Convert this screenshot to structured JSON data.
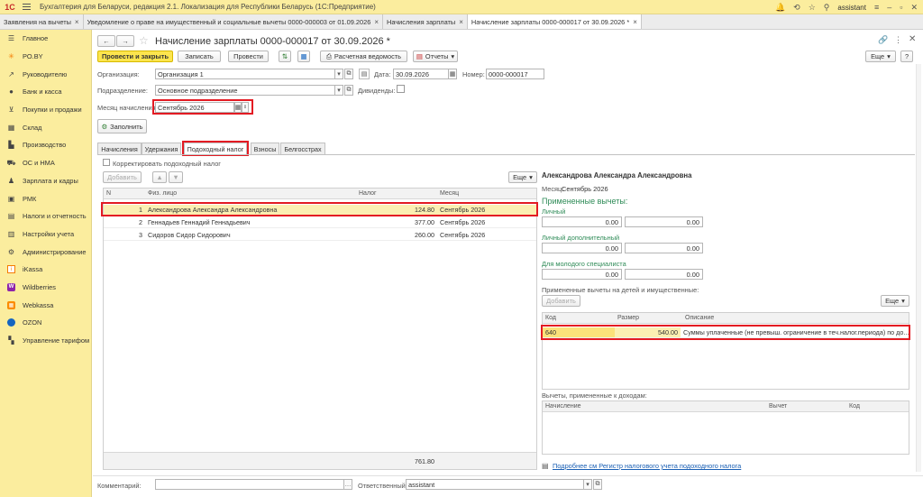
{
  "app": {
    "logo": "1С",
    "title": "Бухгалтерия для Беларуси, редакция 2.1. Локализация для Республики Беларусь   (1С:Предприятие)",
    "user": "assistant"
  },
  "open_tabs": [
    {
      "label": "Заявления на вычеты",
      "close": "×"
    },
    {
      "label": "Уведомление о праве на имущественный и социальные вычеты 0000-000003 от 01.09.2026",
      "close": "×"
    },
    {
      "label": "Начисления зарплаты",
      "close": "×"
    },
    {
      "label": "Начисление зарплаты 0000-000017 от 30.09.2026 *",
      "close": "×"
    }
  ],
  "sidebar": [
    {
      "label": "Главное",
      "icon": "menu-icon"
    },
    {
      "label": "PO.BY",
      "icon": "star-icon"
    },
    {
      "label": "Руководителю",
      "icon": "chart-icon"
    },
    {
      "label": "Банк и касса",
      "icon": "bank-icon"
    },
    {
      "label": "Покупки и продажи",
      "icon": "cart-icon"
    },
    {
      "label": "Склад",
      "icon": "warehouse-icon"
    },
    {
      "label": "Производство",
      "icon": "factory-icon"
    },
    {
      "label": "ОС и НМА",
      "icon": "truck-icon"
    },
    {
      "label": "Зарплата и кадры",
      "icon": "person-icon"
    },
    {
      "label": "РМК",
      "icon": "cashbox-icon"
    },
    {
      "label": "Налоги и отчетность",
      "icon": "tax-icon"
    },
    {
      "label": "Настройки учета",
      "icon": "settings-doc-icon"
    },
    {
      "label": "Администрирование",
      "icon": "gear-icon"
    },
    {
      "label": "iKassa",
      "icon": "ikassa-icon"
    },
    {
      "label": "Wildberries",
      "icon": "wildberries-icon"
    },
    {
      "label": "Webkassa",
      "icon": "webkassa-icon"
    },
    {
      "label": "OZON",
      "icon": "ozon-icon"
    },
    {
      "label": "Управление тарифом",
      "icon": "tariff-icon"
    }
  ],
  "doc": {
    "title": "Начисление зарплаты 0000-000017 от 30.09.2026 *",
    "toolbar": {
      "post_close": "Провести и закрыть",
      "save": "Записать",
      "post": "Провести",
      "payslip": "Расчетная ведомость",
      "reports": "Отчеты",
      "more": "Еще",
      "help": "?"
    },
    "org_label": "Организация:",
    "org_value": "Организация 1",
    "date_label": "Дата:",
    "date_value": "30.09.2026",
    "number_label": "Номер:",
    "number_value": "0000-000017",
    "dept_label": "Подразделение:",
    "dept_value": "Основное подразделение",
    "dividends_label": "Дивиденды:",
    "month_label": "Месяц начисления:",
    "month_value": "Сентябрь 2026",
    "fill_button": "Заполнить"
  },
  "subtabs": [
    "Начисления",
    "Удержания",
    "Подоходный налог",
    "Взносы",
    "Белгосстрах"
  ],
  "left_panel": {
    "correct_label": "Корректировать подоходный налог",
    "add_button": "Добавить",
    "more_button": "Еще",
    "columns": [
      "N",
      "Физ. лицо",
      "Налог",
      "Месяц"
    ],
    "rows": [
      {
        "n": "1",
        "person": "Александрова Александра Александровна",
        "tax": "124.80",
        "month": "Сентябрь 2026"
      },
      {
        "n": "2",
        "person": "Геннадьев Геннадий Геннадьевич",
        "tax": "377.00",
        "month": "Сентябрь 2026"
      },
      {
        "n": "3",
        "person": "Сидоров Сидор Сидорович",
        "tax": "260.00",
        "month": "Сентябрь 2026"
      }
    ],
    "total_tax": "761.80"
  },
  "right_panel": {
    "person": "Александрова Александра Александровна",
    "month_label": "Месяц:",
    "month_value": "Сентябрь 2026",
    "applied_header": "Примененные вычеты:",
    "personal_label": "Личный",
    "personal_a": "0.00",
    "personal_b": "0.00",
    "personal_extra_label": "Личный дополнительный",
    "personal_extra_a": "0.00",
    "personal_extra_b": "0.00",
    "young_label": "Для молодого специалиста",
    "young_a": "0.00",
    "young_b": "0.00",
    "children_label": "Примененные вычеты на детей и имущественные:",
    "add_button": "Добавить",
    "more_button": "Еще",
    "ded_columns": [
      "Код",
      "Размер",
      "Описание"
    ],
    "ded_rows": [
      {
        "code": "640",
        "size": "540.00",
        "desc": "Суммы уплаченные (не превыш. ограничение в теч.налог.периода) по до..."
      }
    ],
    "income_label": "Вычеты, примененные к доходам:",
    "income_columns": [
      "Начисление",
      "Вычет",
      "Код"
    ],
    "register_link": "Подробнее см Регистр налогового учета подоходного налога"
  },
  "footer": {
    "comment_label": "Комментарий:",
    "comment_value": "",
    "responsible_label": "Ответственный:",
    "responsible_value": "assistant"
  }
}
